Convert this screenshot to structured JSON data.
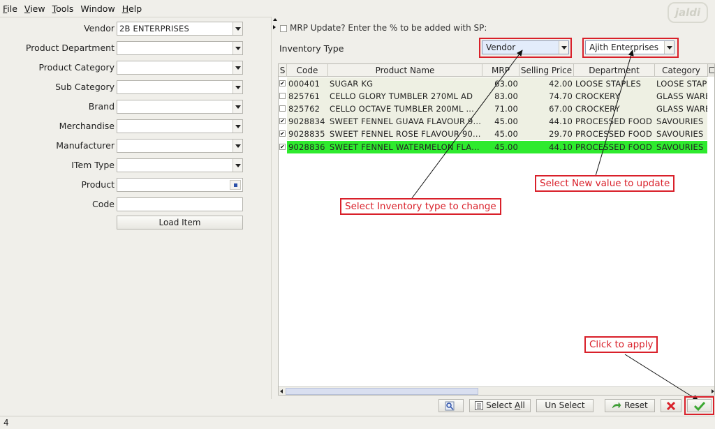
{
  "menu": [
    {
      "first": "F",
      "rest": "ile"
    },
    {
      "first": "V",
      "rest": "iew"
    },
    {
      "first": "T",
      "rest": "ools"
    },
    {
      "first": "",
      "rest": "Window"
    },
    {
      "first": "H",
      "rest": "elp"
    }
  ],
  "logo_text": "jaldi",
  "filters": {
    "vendor": {
      "label": "Vendor",
      "value": "2B ENTERPRISES"
    },
    "product_department": {
      "label": "Product Department",
      "value": ""
    },
    "product_category": {
      "label": "Product Category",
      "value": ""
    },
    "sub_category": {
      "label": "Sub Category",
      "value": ""
    },
    "brand": {
      "label": "Brand",
      "value": ""
    },
    "merchandise": {
      "label": "Merchandise",
      "value": ""
    },
    "manufacturer": {
      "label": "Manufacturer",
      "value": ""
    },
    "item_type": {
      "label": "ITem Type",
      "value": ""
    },
    "product": {
      "label": "Product",
      "value": ""
    },
    "code": {
      "label": "Code",
      "value": ""
    },
    "load_button": "Load Item"
  },
  "mrp_update": {
    "label": "MRP Update? Enter the % to be added with SP:",
    "checked": false
  },
  "inventory_type": {
    "label": "Inventory Type",
    "selected": "Vendor",
    "new_value": "Ajith Enterprises"
  },
  "grid": {
    "columns": [
      "S",
      "Code",
      "Product Name",
      "MRP",
      "Selling Price",
      "Department",
      "Category"
    ],
    "rows": [
      {
        "checked": true,
        "code": "000401",
        "name": "SUGAR KG",
        "mrp": "63.00",
        "sp": "42.00",
        "dept": "LOOSE STAPLES",
        "cat": "LOOSE STAPLES",
        "highlight": false
      },
      {
        "checked": false,
        "code": "825761",
        "name": "CELLO GLORY TUMBLER 270ML AD",
        "mrp": "83.00",
        "sp": "74.70",
        "dept": "CROCKERY",
        "cat": "GLASS WARE",
        "highlight": false
      },
      {
        "checked": false,
        "code": "825762",
        "name": "CELLO OCTAVE TUMBLER 200ML ...",
        "mrp": "71.00",
        "sp": "67.00",
        "dept": "CROCKERY",
        "cat": "GLASS WARE",
        "highlight": false
      },
      {
        "checked": true,
        "code": "9028834",
        "name": "SWEET FENNEL GUAVA FLAVOUR 9...",
        "mrp": "45.00",
        "sp": "44.10",
        "dept": "PROCESSED FOOD",
        "cat": "SAVOURIES",
        "highlight": false
      },
      {
        "checked": true,
        "code": "9028835",
        "name": "SWEET FENNEL ROSE FLAVOUR 90...",
        "mrp": "45.00",
        "sp": "29.70",
        "dept": "PROCESSED FOOD",
        "cat": "SAVOURIES",
        "highlight": false
      },
      {
        "checked": true,
        "code": "9028836",
        "name": "SWEET FENNEL WATERMELON FLA...",
        "mrp": "45.00",
        "sp": "44.10",
        "dept": "PROCESSED FOOD",
        "cat": "SAVOURIES",
        "highlight": true
      }
    ]
  },
  "callouts": {
    "inventory_type": "Select Inventory type to change",
    "new_value": "Select New value to update",
    "apply": "Click to apply"
  },
  "toolbar": {
    "select_all_prefix": "Select ",
    "select_all_u": "A",
    "select_all_rest": "ll",
    "unselect": "Un Select",
    "reset": "Reset"
  },
  "status": {
    "text": "4"
  },
  "colors": {
    "highlight_row": "#2eea2e",
    "callout": "#d9202a",
    "apply_icon": "#3ca832",
    "cancel_icon": "#d9202a"
  }
}
